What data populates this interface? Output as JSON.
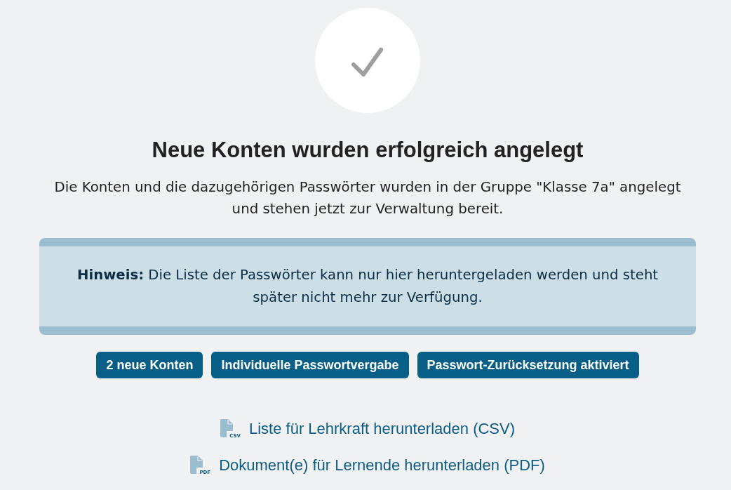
{
  "title": "Neue Konten wurden erfolgreich angelegt",
  "description": "Die Konten und die dazugehörigen Passwörter wurden in der Gruppe \"Klasse 7a\" angelegt und stehen jetzt zur Verwaltung bereit.",
  "notice": {
    "text": "**Hinweis:** Die Liste der Passwörter kann nur hier heruntergeladen werden und steht später nicht mehr zur Verfügung."
  },
  "tags": [
    "2 neue Konten",
    "Individuelle Passwortvergabe",
    "Passwort-Zurücksetzung aktiviert"
  ],
  "downloads": [
    {
      "file_type": "CSV",
      "label": "Liste für Lehrkraft herunterladen (CSV)"
    },
    {
      "file_type": "PDF",
      "label": "Dokument(e) für Lernende herunterladen (PDF)"
    }
  ]
}
